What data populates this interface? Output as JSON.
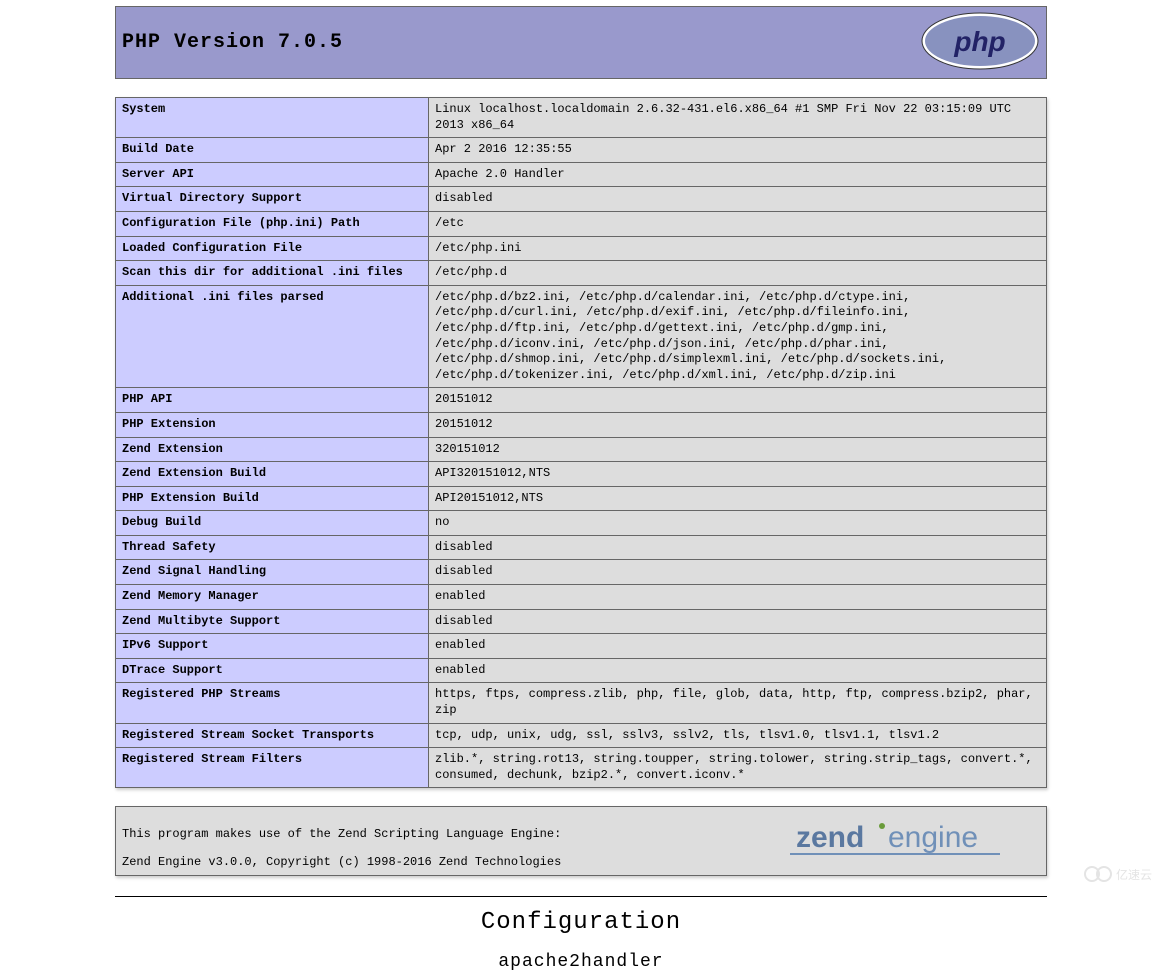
{
  "header": {
    "title": "PHP Version 7.0.5",
    "logo_alt": "php"
  },
  "rows": [
    {
      "label": "System",
      "value": "Linux localhost.localdomain 2.6.32-431.el6.x86_64 #1 SMP Fri Nov 22 03:15:09 UTC 2013 x86_64"
    },
    {
      "label": "Build Date",
      "value": "Apr 2 2016 12:35:55"
    },
    {
      "label": "Server API",
      "value": "Apache 2.0 Handler"
    },
    {
      "label": "Virtual Directory Support",
      "value": "disabled"
    },
    {
      "label": "Configuration File (php.ini) Path",
      "value": "/etc"
    },
    {
      "label": "Loaded Configuration File",
      "value": "/etc/php.ini"
    },
    {
      "label": "Scan this dir for additional .ini files",
      "value": "/etc/php.d"
    },
    {
      "label": "Additional .ini files parsed",
      "value": "/etc/php.d/bz2.ini, /etc/php.d/calendar.ini, /etc/php.d/ctype.ini, /etc/php.d/curl.ini, /etc/php.d/exif.ini, /etc/php.d/fileinfo.ini, /etc/php.d/ftp.ini, /etc/php.d/gettext.ini, /etc/php.d/gmp.ini, /etc/php.d/iconv.ini, /etc/php.d/json.ini, /etc/php.d/phar.ini, /etc/php.d/shmop.ini, /etc/php.d/simplexml.ini, /etc/php.d/sockets.ini, /etc/php.d/tokenizer.ini, /etc/php.d/xml.ini, /etc/php.d/zip.ini"
    },
    {
      "label": "PHP API",
      "value": "20151012"
    },
    {
      "label": "PHP Extension",
      "value": "20151012"
    },
    {
      "label": "Zend Extension",
      "value": "320151012"
    },
    {
      "label": "Zend Extension Build",
      "value": "API320151012,NTS"
    },
    {
      "label": "PHP Extension Build",
      "value": "API20151012,NTS"
    },
    {
      "label": "Debug Build",
      "value": "no"
    },
    {
      "label": "Thread Safety",
      "value": "disabled"
    },
    {
      "label": "Zend Signal Handling",
      "value": "disabled"
    },
    {
      "label": "Zend Memory Manager",
      "value": "enabled"
    },
    {
      "label": "Zend Multibyte Support",
      "value": "disabled"
    },
    {
      "label": "IPv6 Support",
      "value": "enabled"
    },
    {
      "label": "DTrace Support",
      "value": "enabled"
    },
    {
      "label": "Registered PHP Streams",
      "value": "https, ftps, compress.zlib, php, file, glob, data, http, ftp, compress.bzip2, phar, zip"
    },
    {
      "label": "Registered Stream Socket Transports",
      "value": "tcp, udp, unix, udg, ssl, sslv3, sslv2, tls, tlsv1.0, tlsv1.1, tlsv1.2"
    },
    {
      "label": "Registered Stream Filters",
      "value": "zlib.*, string.rot13, string.toupper, string.tolower, string.strip_tags, convert.*, consumed, dechunk, bzip2.*, convert.iconv.*"
    }
  ],
  "zend": {
    "line1": "This program makes use of the Zend Scripting Language Engine:",
    "line2": "Zend  Engine  v3.0.0,  Copyright  (c)  1998-2016  Zend  Technologies",
    "logo_alt": "zend engine"
  },
  "config_heading": "Configuration",
  "section_heading": "apache2handler",
  "watermark": "亿速云"
}
